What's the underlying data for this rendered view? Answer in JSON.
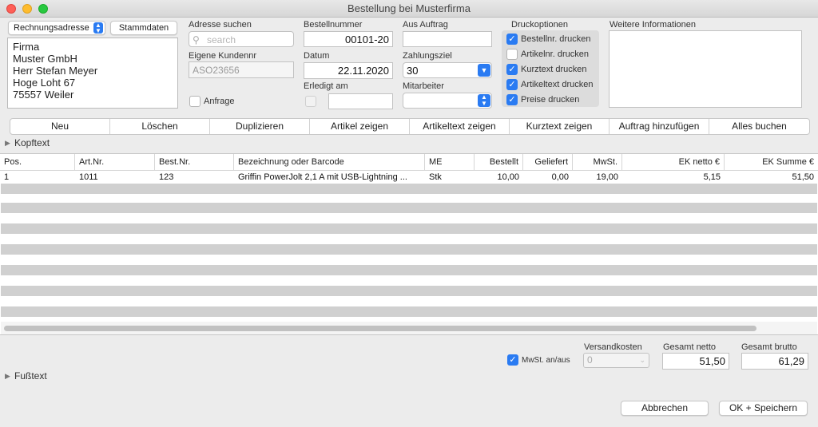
{
  "window": {
    "title": "Bestellung bei Musterfirma"
  },
  "address": {
    "type_select": "Rechnungsadresse",
    "stammdaten_button": "Stammdaten",
    "lines": [
      "Firma",
      "Muster GmbH",
      "Herr Stefan Meyer",
      "Hoge Loht 67",
      "75557 Weiler"
    ]
  },
  "search": {
    "label": "Adresse suchen",
    "placeholder": "search"
  },
  "customer_no": {
    "label": "Eigene Kundennr",
    "value": "ASO23656"
  },
  "inquiry": {
    "label": "Anfrage"
  },
  "order_no": {
    "label": "Bestellnummer",
    "value": "00101-20"
  },
  "date": {
    "label": "Datum",
    "value": "22.11.2020"
  },
  "done": {
    "label": "Erledigt am",
    "value": ""
  },
  "from_order": {
    "label": "Aus Auftrag",
    "value": ""
  },
  "payment": {
    "label": "Zahlungsziel",
    "value": "30"
  },
  "employee": {
    "label": "Mitarbeiter",
    "value": ""
  },
  "print_options": {
    "label": "Druckoptionen",
    "items": [
      {
        "label": "Bestellnr. drucken",
        "checked": true
      },
      {
        "label": "Artikelnr. drucken",
        "checked": false
      },
      {
        "label": "Kurztext drucken",
        "checked": true
      },
      {
        "label": "Artikeltext drucken",
        "checked": true
      },
      {
        "label": "Preise drucken",
        "checked": true
      }
    ]
  },
  "further_info": {
    "label": "Weitere Informationen",
    "value": ""
  },
  "toolbar": [
    "Neu",
    "Löschen",
    "Duplizieren",
    "Artikel zeigen",
    "Artikeltext zeigen",
    "Kurztext zeigen",
    "Auftrag hinzufügen",
    "Alles buchen"
  ],
  "header_text": {
    "label": "Kopftext"
  },
  "table": {
    "columns": [
      "Pos.",
      "Art.Nr.",
      "Best.Nr.",
      "Bezeichnung oder Barcode",
      "ME",
      "Bestellt",
      "Geliefert",
      "MwSt.",
      "EK netto €",
      "EK Summe €"
    ],
    "rows": [
      [
        "1",
        "1011",
        "123",
        "Griffin PowerJolt 2,1 A mit USB-Lightning ...",
        "Stk",
        "10,00",
        "0,00",
        "19,00",
        "5,15",
        "51,50"
      ]
    ]
  },
  "footer": {
    "vat_toggle": {
      "label": "MwSt. an/aus",
      "checked": true
    },
    "shipping": {
      "label": "Versandkosten",
      "value": "0"
    },
    "total_net": {
      "label": "Gesamt netto",
      "value": "51,50"
    },
    "total_gross": {
      "label": "Gesamt brutto",
      "value": "61,29"
    },
    "footer_text": {
      "label": "Fußtext"
    },
    "cancel_button": "Abbrechen",
    "ok_button": "OK + Speichern"
  },
  "colors": {
    "accent": "#2a7bf2",
    "close": "#fe5f57",
    "minimize": "#febc2e",
    "zoom": "#28c840"
  }
}
